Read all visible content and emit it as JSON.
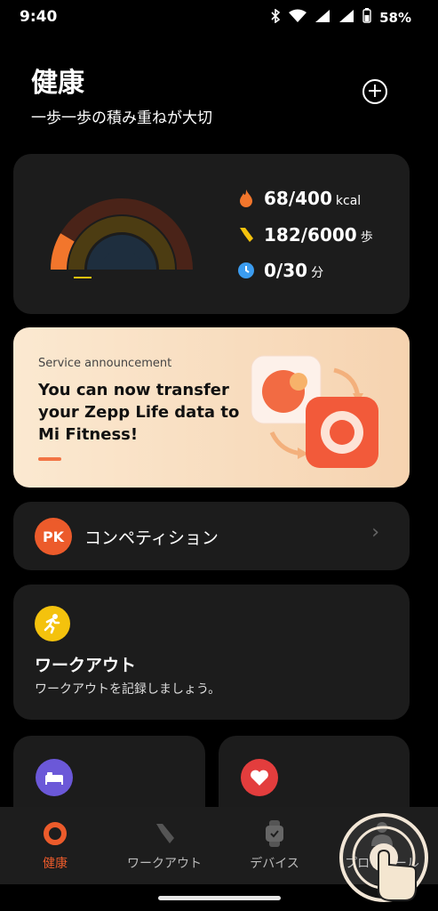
{
  "status_bar": {
    "time": "9:40",
    "battery": "58%"
  },
  "header": {
    "title": "健康",
    "subtitle": "一歩一歩の積み重ねが大切"
  },
  "stats": [
    {
      "icon": "flame-icon",
      "value": "68/400",
      "unit": "kcal",
      "color": "#f2762c"
    },
    {
      "icon": "shoe-icon",
      "value": "182/6000",
      "unit": "歩",
      "color": "#f4c20d"
    },
    {
      "icon": "clock-icon",
      "value": "0/30",
      "unit": "分",
      "color": "#3b9cf0"
    }
  ],
  "progress": {
    "calories_fraction": 0.17,
    "steps_fraction": 0.03,
    "minutes_fraction": 0.0
  },
  "announcement": {
    "label": "Service announcement",
    "title": "You can now transfer your Zepp Life data to Mi Fitness!"
  },
  "competition": {
    "badge": "PK",
    "label": "コンペティション"
  },
  "workout": {
    "title": "ワークアウト",
    "description": "ワークアウトを記録しましょう。"
  },
  "bottom_nav": [
    {
      "label": "健康",
      "active": true
    },
    {
      "label": "ワークアウト",
      "active": false
    },
    {
      "label": "デバイス",
      "active": false
    },
    {
      "label": "プロフィール",
      "active": false
    }
  ],
  "colors": {
    "accent": "#ec5b2b",
    "card": "#1c1c1c",
    "background": "#000000"
  }
}
